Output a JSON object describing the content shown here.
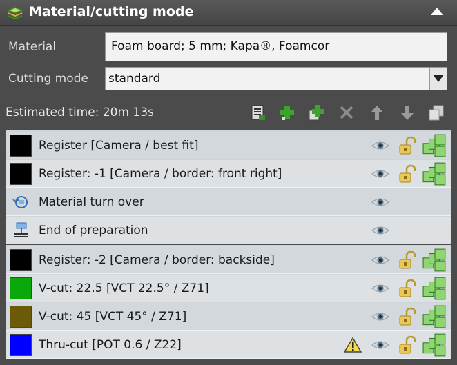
{
  "header": {
    "title": "Material/cutting mode",
    "icon": "material-stack-icon"
  },
  "material": {
    "label": "Material",
    "value": "Foam board; 5 mm; Kapa®, Foamcor"
  },
  "cutting_mode": {
    "label": "Cutting mode",
    "value": "standard"
  },
  "toolbar": {
    "estimated_time": "Estimated time: 20m 13s",
    "icons": [
      "list-edit-icon",
      "add-icon",
      "add-copy-icon",
      "delete-icon",
      "move-up-icon",
      "move-down-icon",
      "duplicate-icon"
    ]
  },
  "groups": [
    {
      "rows": [
        {
          "label": "Register [Camera / best fit]",
          "color": "#000000",
          "lock": true,
          "layers": true
        },
        {
          "label": "Register: -1 [Camera / border: front right]",
          "color": "#000000",
          "lock": true,
          "layers": true
        },
        {
          "label": "Material turn over",
          "icon": "turn-over-icon",
          "lock": false,
          "layers": false
        },
        {
          "label": "End of preparation",
          "icon": "end-preparation-icon",
          "lock": false,
          "layers": false
        }
      ]
    },
    {
      "rows": [
        {
          "label": "Register: -2 [Camera / border: backside]",
          "color": "#000000",
          "lock": true,
          "layers": true
        },
        {
          "label": "V-cut: 22.5 [VCT 22.5° / Z71]",
          "color": "#0aa80a",
          "lock": true,
          "layers": true
        },
        {
          "label": "V-cut: 45 [VCT 45° / Z71]",
          "color": "#6b5a07",
          "lock": true,
          "layers": true
        },
        {
          "label": "Thru-cut [POT 0.6 / Z22]",
          "color": "#0000ff",
          "lock": true,
          "layers": true,
          "warning": true
        }
      ]
    }
  ]
}
